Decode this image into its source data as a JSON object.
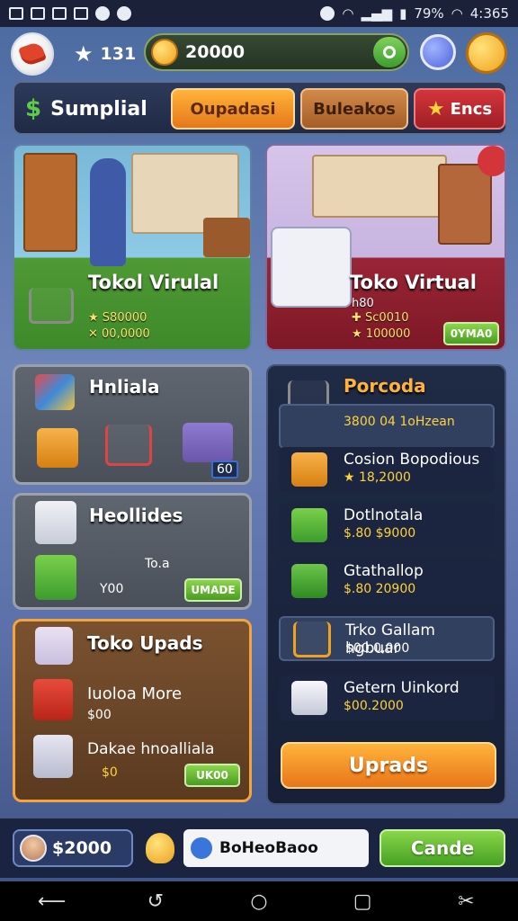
{
  "status_bar": {
    "battery": "79%",
    "time": "4:365"
  },
  "header": {
    "rank": "131",
    "coins": "20000"
  },
  "tabs": {
    "brand_label": "Sumplial",
    "items": [
      {
        "label": "Oupadasi"
      },
      {
        "label": "Buleakos"
      },
      {
        "label": "Encs"
      }
    ]
  },
  "hero_cards": [
    {
      "title": "Tokol Virulal",
      "line1": "S80000",
      "line2": "00,0000"
    },
    {
      "title": "Toko Virtual",
      "line0": "h80",
      "line1": "Sc0010",
      "line2": "100000",
      "button": "0YMA0"
    }
  ],
  "left_panels": {
    "hnliala": {
      "title": "Hnliala",
      "badge": "60"
    },
    "heollides": {
      "title": "Heollides",
      "note": "To.a",
      "price": "Y00",
      "button": "UMADE"
    },
    "toko_upads": {
      "title": "Toko Upads",
      "items": [
        {
          "title": "Iuoloa More",
          "price": "$00"
        },
        {
          "title": "Dakae hnoalliala",
          "price": "$0",
          "button": "UK00"
        }
      ]
    }
  },
  "right_panel": {
    "title": "Porcoda",
    "rows": [
      {
        "title": "",
        "sub": "3800 04 1oHzean"
      },
      {
        "title": "Cosion Bopodious",
        "sub": "18,2000"
      },
      {
        "title": "Dotlnotala",
        "sub": "$.80 $9000"
      },
      {
        "title": "Gtathallop",
        "sub": "$.80 20900"
      },
      {
        "title": "Trko Gallam hgbuar",
        "sub": "$00.0,000"
      },
      {
        "title": "Getern Uinkord",
        "sub": "$00.2000"
      }
    ],
    "upgrade_button": "Uprads"
  },
  "bottom_bar": {
    "wallet": "$2000",
    "chat_text": "BoHeoBaoo",
    "action_button": "Cande"
  },
  "colors": {
    "accent_orange": "#e8761a",
    "accent_green": "#4a9c22",
    "panel_dark": "#1f2a45",
    "coin_gold": "#f0a21c"
  }
}
